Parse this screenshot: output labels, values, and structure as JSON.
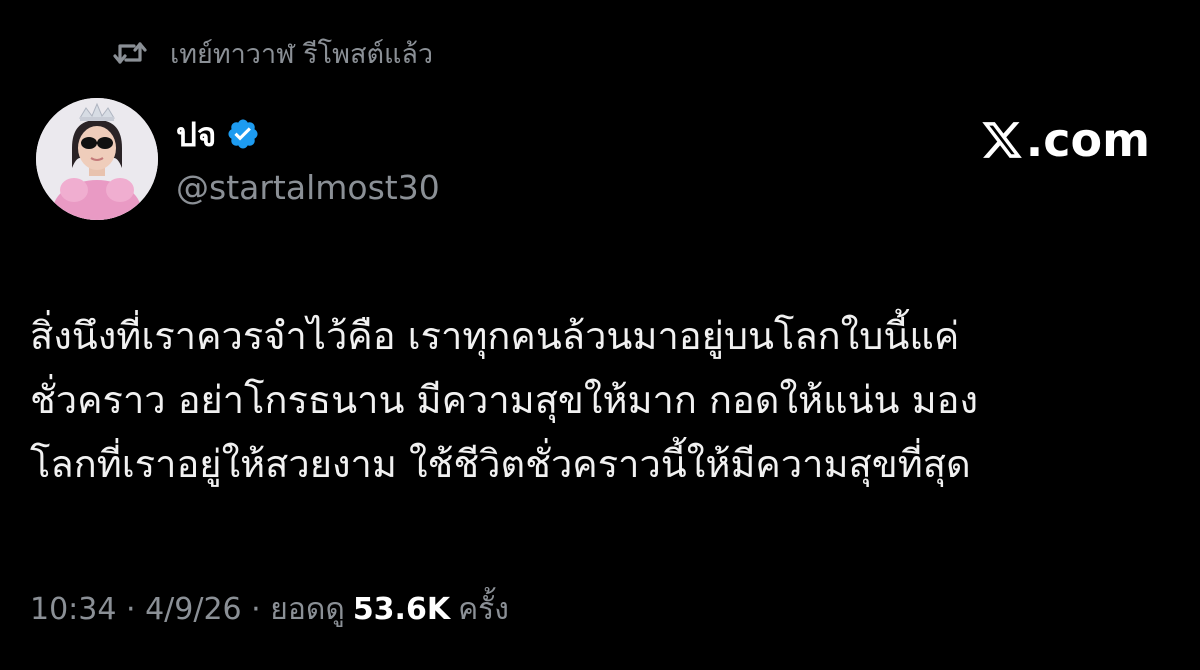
{
  "repost": {
    "icon": "repost-icon",
    "text": "เทย์ทาวาฬ รีโพสต์แล้ว"
  },
  "author": {
    "display_name": "ปจ",
    "verified": true,
    "verified_color": "#1d9bf0",
    "handle": "@startalmost30"
  },
  "brand": {
    "icon": "x-logo-icon",
    "suffix": ".com"
  },
  "tweet": {
    "lines": [
      "สิ่งนึงที่เราควรจำไว้คือ เราทุกคนล้วนมาอยู่บนโลกใบนี้แค่",
      "ชั่วคราว อย่าโกรธนาน มีความสุขให้มาก กอดให้แน่น มอง",
      "โลกที่เราอยู่ให้สวยงาม ใช้ชีวิตชั่วคราวนี้ให้มีความสุขที่สุด"
    ]
  },
  "meta": {
    "time": "10:34",
    "separator": " · ",
    "date": "4/9/26",
    "views_label": "ยอดดู",
    "views_count": "53.6K",
    "views_unit": "ครั้ง"
  },
  "colors": {
    "background": "#000000",
    "primary_text": "#ffffff",
    "secondary_text": "#8b9096"
  }
}
